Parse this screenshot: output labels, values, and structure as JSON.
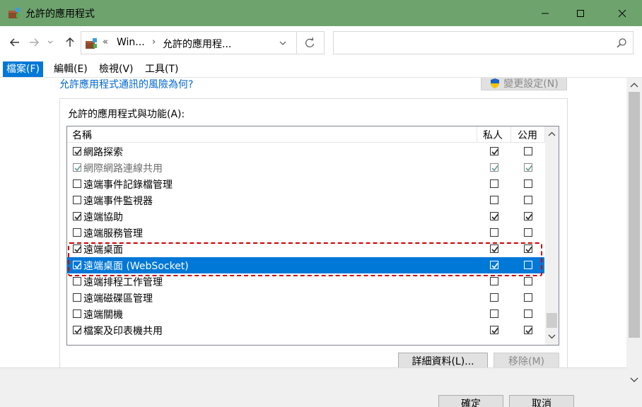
{
  "window": {
    "title": "允許的應用程式"
  },
  "address": {
    "overflow": "«",
    "crumb1": "Win...",
    "crumb2": "允許的應用程...",
    "separator": "›"
  },
  "menu": [
    "檔案(F)",
    "編輯(E)",
    "檢視(V)",
    "工具(T)"
  ],
  "content": {
    "risk_link": "允許應用程式通訊的風險為何?",
    "change_settings": "變更設定(N)",
    "group_label": "允許的應用程式與功能(A):",
    "columns": {
      "name": "名稱",
      "private": "私人",
      "public": "公用"
    },
    "rows": [
      {
        "name": "網路探索",
        "enabled": true,
        "private": true,
        "public": false
      },
      {
        "name": "網際網路連線共用",
        "enabled": true,
        "private": true,
        "public": true,
        "disabled": true
      },
      {
        "name": "遠端事件記錄檔管理",
        "enabled": false,
        "private": false,
        "public": false
      },
      {
        "name": "遠端事件監視器",
        "enabled": false,
        "private": false,
        "public": false
      },
      {
        "name": "遠端協助",
        "enabled": true,
        "private": true,
        "public": true
      },
      {
        "name": "遠端服務管理",
        "enabled": false,
        "private": false,
        "public": false
      },
      {
        "name": "遠端桌面",
        "enabled": true,
        "private": true,
        "public": true
      },
      {
        "name": "遠端桌面 (WebSocket)",
        "enabled": true,
        "private": true,
        "public": false,
        "selected": true
      },
      {
        "name": "遠端排程工作管理",
        "enabled": false,
        "private": false,
        "public": false
      },
      {
        "name": "遠端磁碟區管理",
        "enabled": false,
        "private": false,
        "public": false
      },
      {
        "name": "遠端關機",
        "enabled": false,
        "private": false,
        "public": false
      },
      {
        "name": "檔案及印表機共用",
        "enabled": true,
        "private": true,
        "public": true
      }
    ],
    "details_button": "詳細資料(L)...",
    "remove_button": "移除(M)",
    "ok_button": "確定",
    "cancel_button": "取消"
  },
  "colors": {
    "titlebar": "#6ea36e",
    "accent": "#0078d7",
    "link": "#0066cc",
    "highlight": "#cc0000"
  }
}
